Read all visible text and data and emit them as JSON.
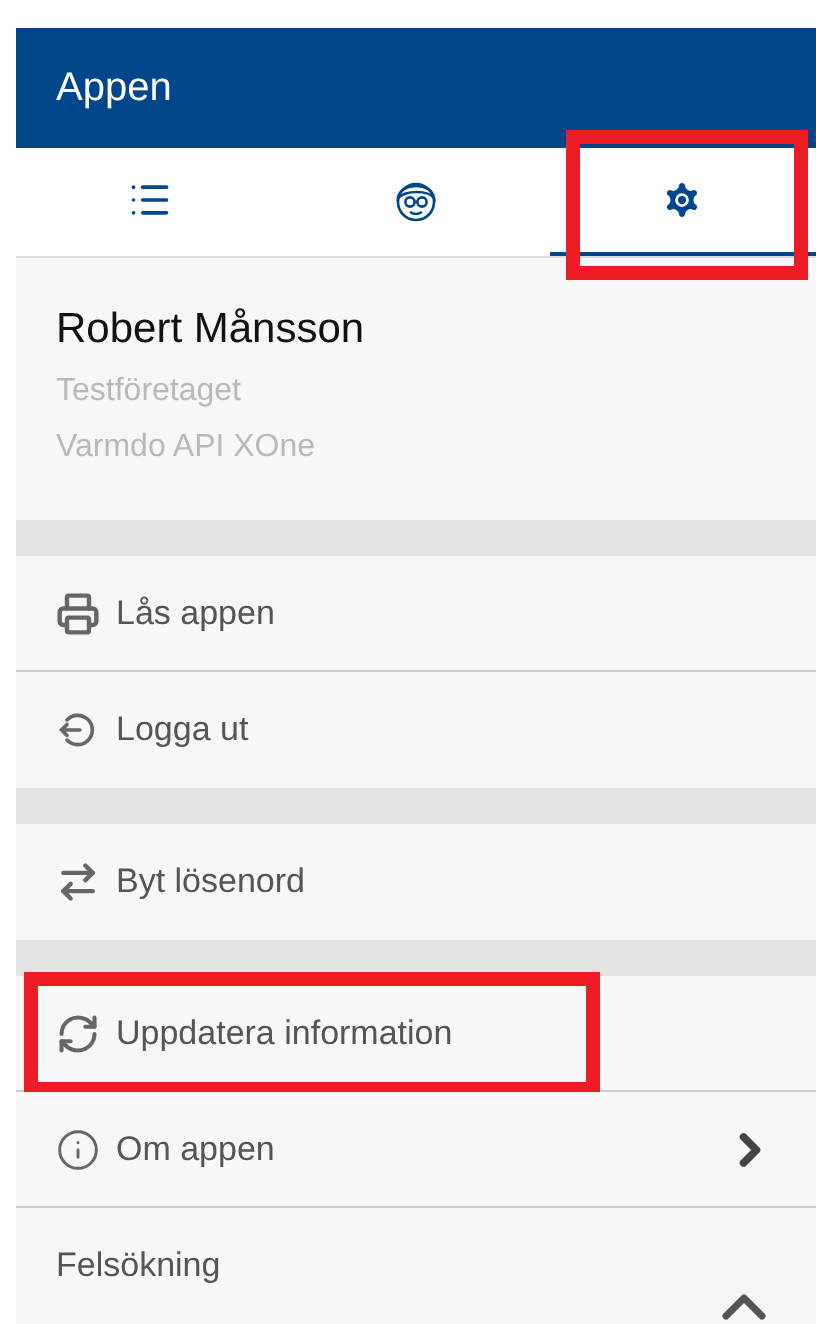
{
  "header": {
    "title": "Appen"
  },
  "tabs": [
    {
      "selected": false,
      "highlighted": false
    },
    {
      "selected": false,
      "highlighted": false
    },
    {
      "selected": true,
      "highlighted": true
    }
  ],
  "profile": {
    "name": "Robert Månsson",
    "company": "Testföretaget",
    "database": "Varmdo API XOne"
  },
  "groups": [
    [
      {
        "label": "Lås appen",
        "highlighted": false,
        "kind": "action"
      },
      {
        "label": "Logga ut",
        "highlighted": false,
        "kind": "action"
      }
    ],
    [
      {
        "label": "Byt lösenord",
        "highlighted": false,
        "kind": "action"
      }
    ],
    [
      {
        "label": "Uppdatera information",
        "highlighted": true,
        "kind": "action"
      },
      {
        "label": "Om appen",
        "highlighted": false,
        "kind": "link"
      },
      {
        "label": "Felsökning",
        "highlighted": false,
        "kind": "section",
        "expanded": true
      }
    ]
  ]
}
